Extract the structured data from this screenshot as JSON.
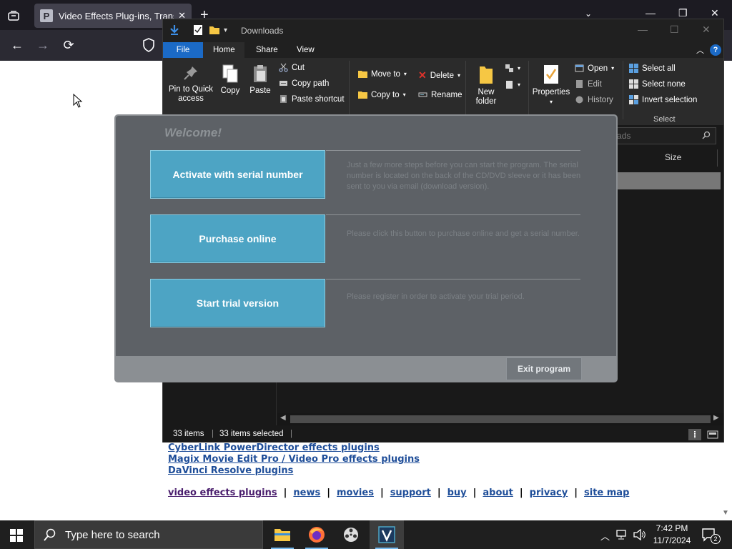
{
  "browser": {
    "tab_title": "Video Effects Plug-ins, Transitions",
    "tab_favicon_letter": "P",
    "tab_close": "✕",
    "new_tab": "+",
    "tab_list": "⌄",
    "win_minimize": "—",
    "win_restore": "❐",
    "win_close": "✕",
    "back": "←",
    "forward": "→",
    "reload": "⟳"
  },
  "page": {
    "links": [
      "CyberLink PowerDirector effects plugins",
      "Magix Movie Edit Pro / Video Pro effects plugins",
      "DaVinci Resolve plugins"
    ],
    "nav": [
      "video effects plugins",
      "news",
      "movies",
      "support",
      "buy",
      "about",
      "privacy",
      "site map"
    ],
    "nav_separator": "|"
  },
  "explorer": {
    "title": "Downloads",
    "tabs": [
      "File",
      "Home",
      "Share",
      "View"
    ],
    "ribbon": {
      "pin": "Pin to Quick access",
      "pin_line1": "Pin to Quick",
      "pin_line2": "access",
      "copy": "Copy",
      "paste": "Paste",
      "cut": "Cut",
      "copy_path": "Copy path",
      "paste_shortcut": "Paste shortcut",
      "move_to": "Move to",
      "copy_to": "Copy to",
      "delete": "Delete",
      "rename": "Rename",
      "new_folder_line1": "New",
      "new_folder_line2": "folder",
      "properties": "Properties",
      "open": "Open",
      "edit": "Edit",
      "history": "History",
      "select_all": "Select all",
      "select_none": "Select none",
      "invert_selection": "Invert selection",
      "group_select": "Select"
    },
    "search_placeholder": "nloads",
    "column_size": "Size",
    "status_items": "33 items",
    "status_selected": "33 items selected",
    "status_sep": "|"
  },
  "dialog": {
    "title": "Welcome!",
    "buttons": [
      {
        "label": "Activate with serial number",
        "desc": "Just a few more steps before you can start the program. The serial number is located on the back of the CD/DVD sleeve or it has been sent to you via email (download version)."
      },
      {
        "label": "Purchase online",
        "desc": "Please click this button to purchase online and get a serial number."
      },
      {
        "label": "Start trial version",
        "desc": "Please register in order to activate your trial period."
      }
    ],
    "exit": "Exit program",
    "colors": {
      "button": "#4da4c4",
      "panel": "#5d6166"
    }
  },
  "taskbar": {
    "search_text": "Type here to search",
    "time": "7:42 PM",
    "date": "11/7/2024",
    "notification_count": "2"
  }
}
